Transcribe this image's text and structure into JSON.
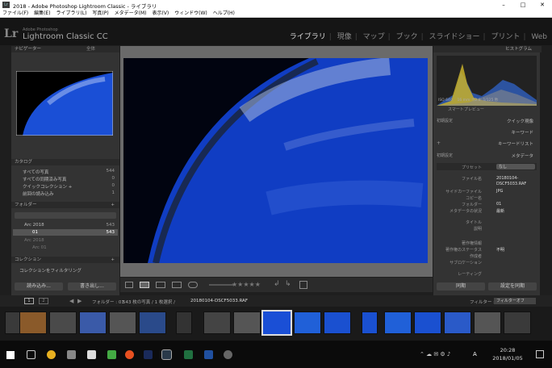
{
  "window": {
    "title": "2018 - Adobe Photoshop Lightroom Classic - ライブラリ"
  },
  "menu": [
    "ファイル(F)",
    "編集(E)",
    "ライブラリ(L)",
    "写真(P)",
    "メタデータ(M)",
    "表示(V)",
    "ウィンドウ(W)",
    "ヘルプ(H)"
  ],
  "identity": {
    "logo": "Lr",
    "line1": "Adobe Photoshop",
    "line2": "Lightroom Classic CC"
  },
  "modules": [
    "ライブラリ",
    "現像",
    "マップ",
    "ブック",
    "スライドショー",
    "プリント",
    "Web"
  ],
  "left": {
    "navigator": "ナビゲーター",
    "nav_zoom": "全体",
    "catalog": "カタログ",
    "catalog_items": [
      {
        "label": "すべての写真",
        "count": "544"
      },
      {
        "label": "すべての同期済み写真",
        "count": "0"
      },
      {
        "label": "クイックコレクション +",
        "count": "0"
      },
      {
        "label": "前回の読み込み",
        "count": "1"
      }
    ],
    "folders": "フォルダー",
    "folder_items": [
      {
        "label": "Arc 2018",
        "count": "543"
      },
      {
        "label": "01",
        "count": "543"
      },
      {
        "label": "Arc 2018",
        "count": ""
      },
      {
        "label": "Arc 01",
        "count": ""
      }
    ],
    "collections": "コレクション",
    "collection_filter": "コレクションをフィルタリング",
    "import": "読み込み...",
    "export": "書き出し..."
  },
  "right": {
    "histogram": "ヒストグラム",
    "hist_info": [
      "ISO 640",
      "16 mm",
      "f/2.8",
      "1/125 秒"
    ],
    "smart_preview": "スマートプレビュー",
    "rows": [
      {
        "l": "初期設定",
        "r": "クイック現像"
      },
      {
        "l": "",
        "r": "キーワード"
      },
      {
        "l": "+",
        "r": "キーワードリスト"
      },
      {
        "l": "初期設定",
        "r": "メタデータ"
      }
    ],
    "preset": "プリセット",
    "preset_val": "なし",
    "meta": [
      {
        "k": "ファイル名",
        "v": "20180104-"
      },
      {
        "k": "",
        "v": "DSCF5033.RAF"
      },
      {
        "k": "サイドカーファイル",
        "v": "JPG"
      },
      {
        "k": "コピー名",
        "v": ""
      },
      {
        "k": "フォルダー",
        "v": "01"
      },
      {
        "k": "メタデータの状況",
        "v": "最新"
      },
      {
        "k": "タイトル",
        "v": ""
      },
      {
        "k": "説明",
        "v": ""
      },
      {
        "k": "著作権情報",
        "v": ""
      },
      {
        "k": "著作権のステータス",
        "v": "不明"
      },
      {
        "k": "作成者",
        "v": ""
      },
      {
        "k": "サブロケーション",
        "v": ""
      },
      {
        "k": "レーティング",
        "v": ""
      }
    ],
    "sync": "同期",
    "sync_settings": "設定を同期"
  },
  "filmbar": {
    "pages": [
      "1",
      "2"
    ],
    "path": "フォルダー : 01",
    "count": "543 枚の写真 / 1 枚選択 / ",
    "file": "20180104-DSCF5033.RAF",
    "filter": "フィルター :",
    "filter_val": "フィルターオフ"
  },
  "taskbar": {
    "time": "20:28",
    "date": "2018/01/05",
    "lang": "A"
  }
}
